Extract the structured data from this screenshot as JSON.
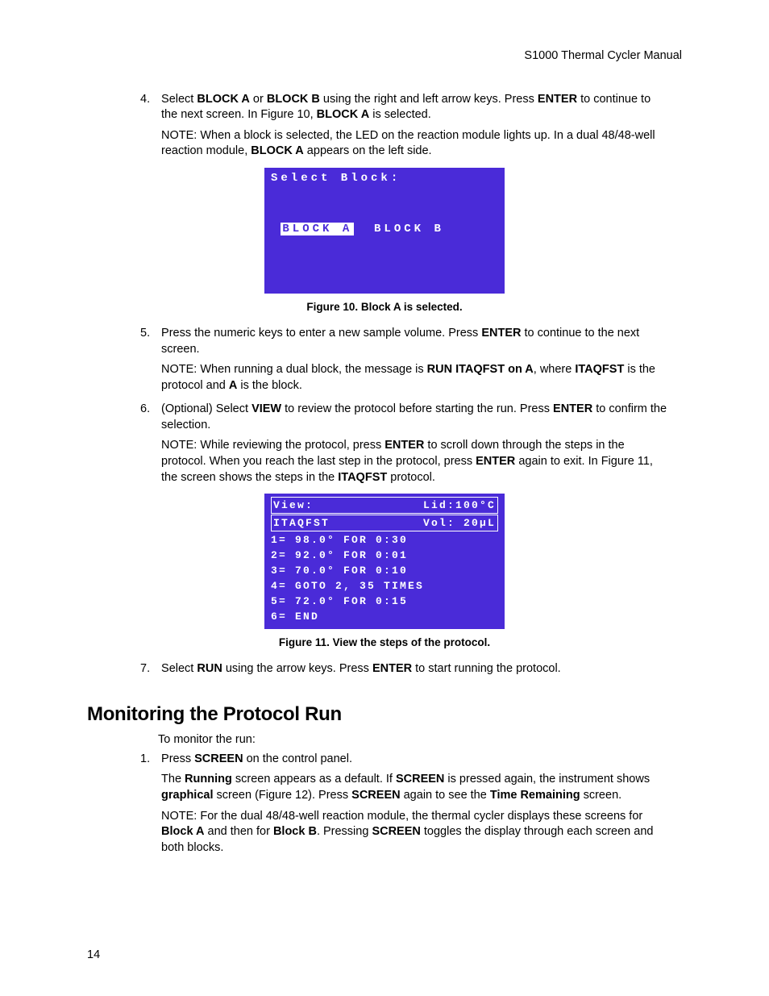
{
  "header": {
    "title": "S1000 Thermal Cycler Manual"
  },
  "page_number": "14",
  "steps": {
    "s4": {
      "num": "4.",
      "para": "Select <b>BLOCK A</b> or <b>BLOCK B</b> using the right and left arrow keys. Press <b>ENTER</b> to continue to the next screen. In Figure 10, <b>BLOCK A</b> is selected.",
      "note": "NOTE: When a block is selected, the LED on the reaction module lights up. In a dual 48/48-well reaction module, <b>BLOCK A</b> appears on the left side."
    },
    "s5": {
      "num": "5.",
      "para": "Press the numeric keys to enter a new sample volume. Press <b>ENTER</b> to continue to the next screen.",
      "note": "NOTE: When running a dual block, the message is <b>RUN ITAQFST on A</b>, where <b>ITAQFST</b> is the protocol and <b>A</b> is the block."
    },
    "s6": {
      "num": "6.",
      "para": "(Optional) Select <b>VIEW</b> to review the protocol before starting the run. Press <b>ENTER</b> to confirm the selection.",
      "note": "NOTE: While reviewing the protocol, press <b>ENTER</b> to scroll down through the steps in the protocol. When you reach the last step in the protocol, press <b>ENTER</b> again to exit. In Figure 11, the screen shows the steps in the <b>ITAQFST</b> protocol."
    },
    "s7": {
      "num": "7.",
      "para": "Select <b>RUN</b> using the arrow keys. Press <b>ENTER</b> to start running the protocol."
    }
  },
  "fig10": {
    "title": "Select Block:",
    "opt_a": "BLOCK A",
    "opt_b": "BLOCK B",
    "caption": "Figure 10. Block A is selected."
  },
  "fig11": {
    "header_left1": "View:",
    "header_right1": "Lid:100°C",
    "header_left2": "ITAQFST",
    "header_right2": "Vol: 20µL",
    "rows": [
      " 1= 98.0° FOR 0:30",
      " 2= 92.0° FOR 0:01",
      " 3= 70.0° FOR 0:10",
      " 4= GOTO  2, 35 TIMES",
      " 5= 72.0° FOR 0:15",
      " 6= END"
    ],
    "caption": "Figure 11. View the steps of the protocol."
  },
  "section2": {
    "heading": "Monitoring the Protocol Run",
    "intro": "To monitor the run:",
    "s1": {
      "num": "1.",
      "para": "Press <b>SCREEN</b> on the control panel.",
      "p2": "The <b>Running</b> screen appears as a default. If <b>SCREEN</b> is pressed again, the instrument shows <b>graphical</b> screen (Figure 12). Press <b>SCREEN</b> again to see the <b>Time Remaining</b> screen.",
      "note": "NOTE: For the dual 48/48-well reaction module, the thermal cycler displays these screens for <b>Block A</b> and then for <b>Block B</b>. Pressing <b>SCREEN</b> toggles the display through each screen and both blocks."
    }
  }
}
